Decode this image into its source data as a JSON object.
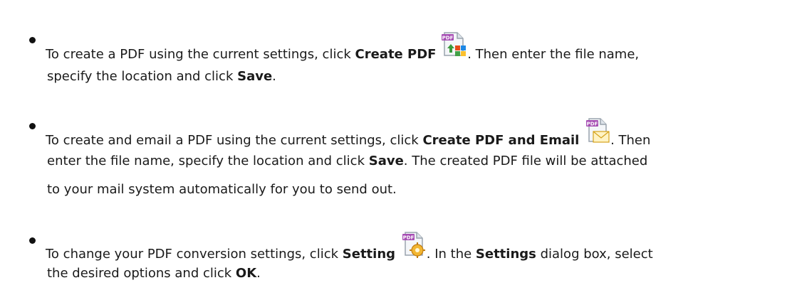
{
  "bullets": [
    {
      "line1": {
        "pre": "To create a PDF using the current settings, click ",
        "bold": "Create PDF",
        "post": ". Then enter the file name,"
      },
      "line2": {
        "pre": "specify the location and click ",
        "bold": "Save",
        "post": "."
      },
      "icon": "create-pdf-icon"
    },
    {
      "line1": {
        "pre": "To create and email a PDF using the current settings, click ",
        "bold": "Create PDF and Email",
        "post": ". Then"
      },
      "line2": {
        "pre": "enter the file name, specify the location and click ",
        "bold": "Save",
        "post": ". The created PDF file will be attached"
      },
      "line3": {
        "text": "to your mail system automatically for you to send out."
      },
      "icon": "email-pdf-icon"
    },
    {
      "line1": {
        "pre": "To change your PDF conversion settings, click ",
        "bold": "Setting",
        "mid": ". In the ",
        "bold2": "Settings",
        "post": " dialog box, select"
      },
      "line2": {
        "pre": "the desired options and click ",
        "bold": "OK",
        "post": "."
      },
      "icon": "settings-pdf-icon"
    }
  ],
  "icon_badge_text": "PDF",
  "colors": {
    "text": "#1a1a1a",
    "bullet": "#111111",
    "pdf_badge": "#a64db3"
  }
}
